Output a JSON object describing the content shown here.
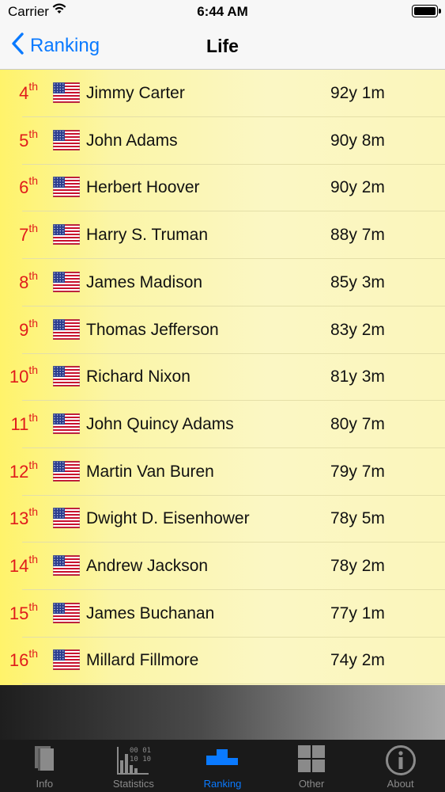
{
  "status_bar": {
    "carrier": "Carrier",
    "time": "6:44 AM"
  },
  "nav": {
    "back_label": "Ranking",
    "title": "Life"
  },
  "colors": {
    "accent": "#0a7aff",
    "rank": "#e01b1b",
    "list_bg_left": "#fff36a",
    "list_bg_right": "#fbf6bc"
  },
  "rows": [
    {
      "rank": "4",
      "suffix": "th",
      "flag": "us-flag-icon",
      "name": "Jimmy Carter",
      "age": "92y 1m"
    },
    {
      "rank": "5",
      "suffix": "th",
      "flag": "us-flag-icon",
      "name": "John Adams",
      "age": "90y 8m"
    },
    {
      "rank": "6",
      "suffix": "th",
      "flag": "us-flag-icon",
      "name": "Herbert Hoover",
      "age": "90y 2m"
    },
    {
      "rank": "7",
      "suffix": "th",
      "flag": "us-flag-icon",
      "name": "Harry S. Truman",
      "age": "88y 7m"
    },
    {
      "rank": "8",
      "suffix": "th",
      "flag": "us-flag-icon",
      "name": "James Madison",
      "age": "85y 3m"
    },
    {
      "rank": "9",
      "suffix": "th",
      "flag": "us-flag-icon",
      "name": "Thomas Jefferson",
      "age": "83y 2m"
    },
    {
      "rank": "10",
      "suffix": "th",
      "flag": "us-flag-icon",
      "name": "Richard Nixon",
      "age": "81y 3m"
    },
    {
      "rank": "11",
      "suffix": "th",
      "flag": "us-flag-icon",
      "name": "John Quincy Adams",
      "age": "80y 7m"
    },
    {
      "rank": "12",
      "suffix": "th",
      "flag": "us-flag-icon",
      "name": "Martin Van Buren",
      "age": "79y 7m"
    },
    {
      "rank": "13",
      "suffix": "th",
      "flag": "us-flag-icon",
      "name": "Dwight D. Eisenhower",
      "age": "78y 5m"
    },
    {
      "rank": "14",
      "suffix": "th",
      "flag": "us-flag-icon",
      "name": "Andrew Jackson",
      "age": "78y 2m"
    },
    {
      "rank": "15",
      "suffix": "th",
      "flag": "us-flag-icon",
      "name": "James Buchanan",
      "age": "77y 1m"
    },
    {
      "rank": "16",
      "suffix": "th",
      "flag": "us-flag-icon",
      "name": "Millard Fillmore",
      "age": "74y 2m"
    }
  ],
  "tabs": [
    {
      "label": "Info",
      "icon": "book-icon",
      "active": false
    },
    {
      "label": "Statistics",
      "icon": "statistics-icon",
      "active": false
    },
    {
      "label": "Ranking",
      "icon": "podium-icon",
      "active": true
    },
    {
      "label": "Other",
      "icon": "grid-icon",
      "active": false
    },
    {
      "label": "About",
      "icon": "info-icon",
      "active": false
    }
  ]
}
